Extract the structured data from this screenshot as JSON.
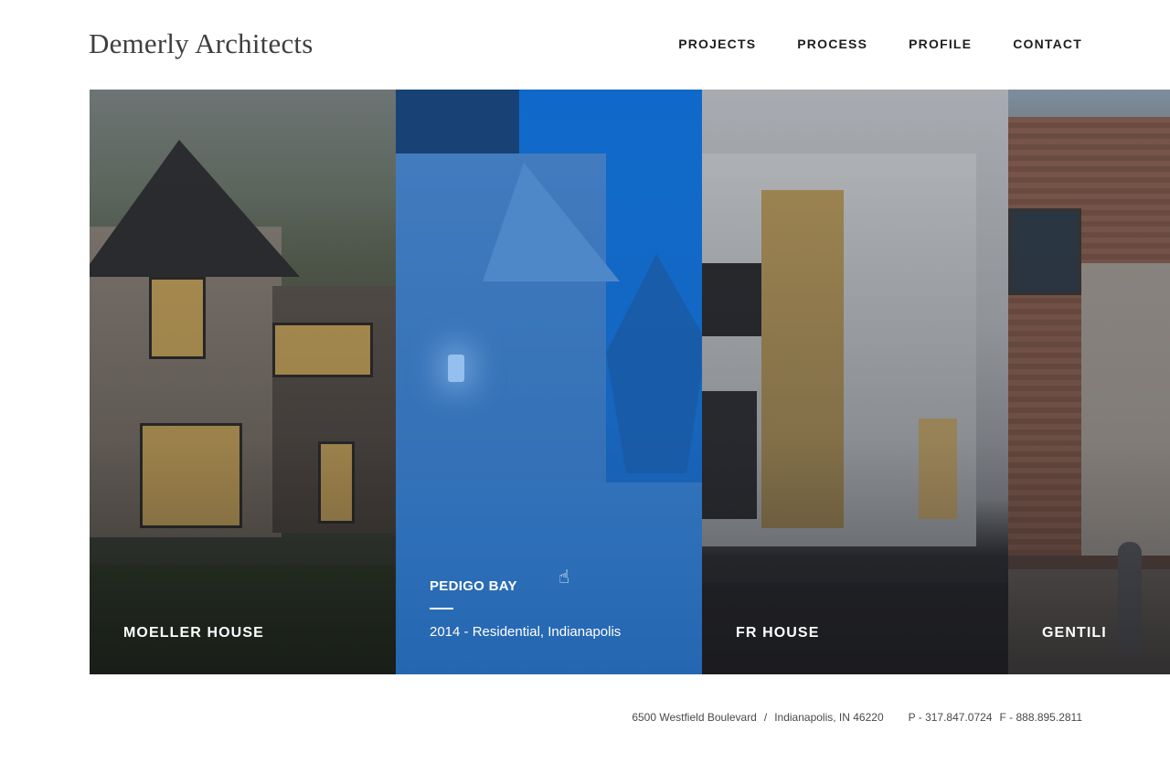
{
  "header": {
    "logo_text": "Demerly Architects",
    "nav": [
      {
        "label": "PROJECTS"
      },
      {
        "label": "PROCESS"
      },
      {
        "label": "PROFILE"
      },
      {
        "label": "CONTACT"
      }
    ]
  },
  "slider": {
    "panels": [
      {
        "title": "MOELLER HOUSE"
      },
      {
        "title": "PEDIGO BAY",
        "meta": "2014 - Residential, Indianapolis",
        "state": "hover"
      },
      {
        "title": "FR HOUSE"
      },
      {
        "title": "GENTILI"
      }
    ]
  },
  "footer": {
    "street": "6500 Westfield Boulevard",
    "separator": "/",
    "city": "Indianapolis, IN 46220",
    "phone": "P - 317.847.0724",
    "fax": "F - 888.895.2811"
  },
  "colors": {
    "hover_overlay": "#1a6ecd",
    "text_dark": "#1e1e1e",
    "logo": "#3f3f3f"
  },
  "icons": {
    "cursor": "hand-pointer-icon"
  }
}
